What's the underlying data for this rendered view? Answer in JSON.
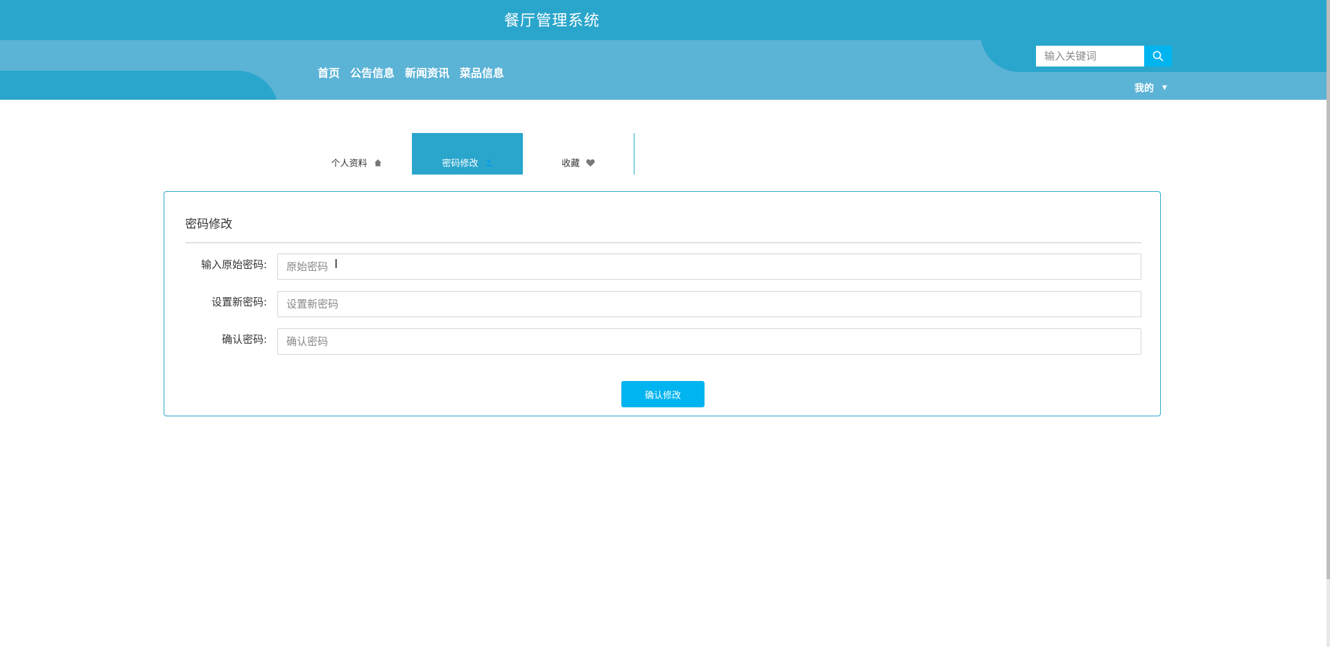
{
  "header": {
    "site_title": "餐厅管理系统",
    "nav": [
      "首页",
      "公告信息",
      "新闻资讯",
      "菜品信息"
    ],
    "search": {
      "placeholder": "输入关键词",
      "icon": "search-icon"
    },
    "user_menu": {
      "label": "我的",
      "icon": "caret-down-icon"
    }
  },
  "tabs": [
    {
      "label": "个人资料",
      "icon": "home-icon",
      "active": false
    },
    {
      "label": "密码修改",
      "icon": "user-icon",
      "active": true
    },
    {
      "label": "收藏",
      "icon": "heart-icon",
      "active": false
    }
  ],
  "panel": {
    "title": "密码修改",
    "fields": [
      {
        "label": "输入原始密码:",
        "placeholder": "原始密码",
        "value": ""
      },
      {
        "label": "设置新密码:",
        "placeholder": "设置新密码",
        "value": ""
      },
      {
        "label": "确认密码:",
        "placeholder": "确认密码",
        "value": ""
      }
    ],
    "submit_label": "确认修改"
  },
  "colors": {
    "primary": "#2aa6cc",
    "nav_band": "#5bb3d6",
    "accent": "#00b4ef"
  }
}
